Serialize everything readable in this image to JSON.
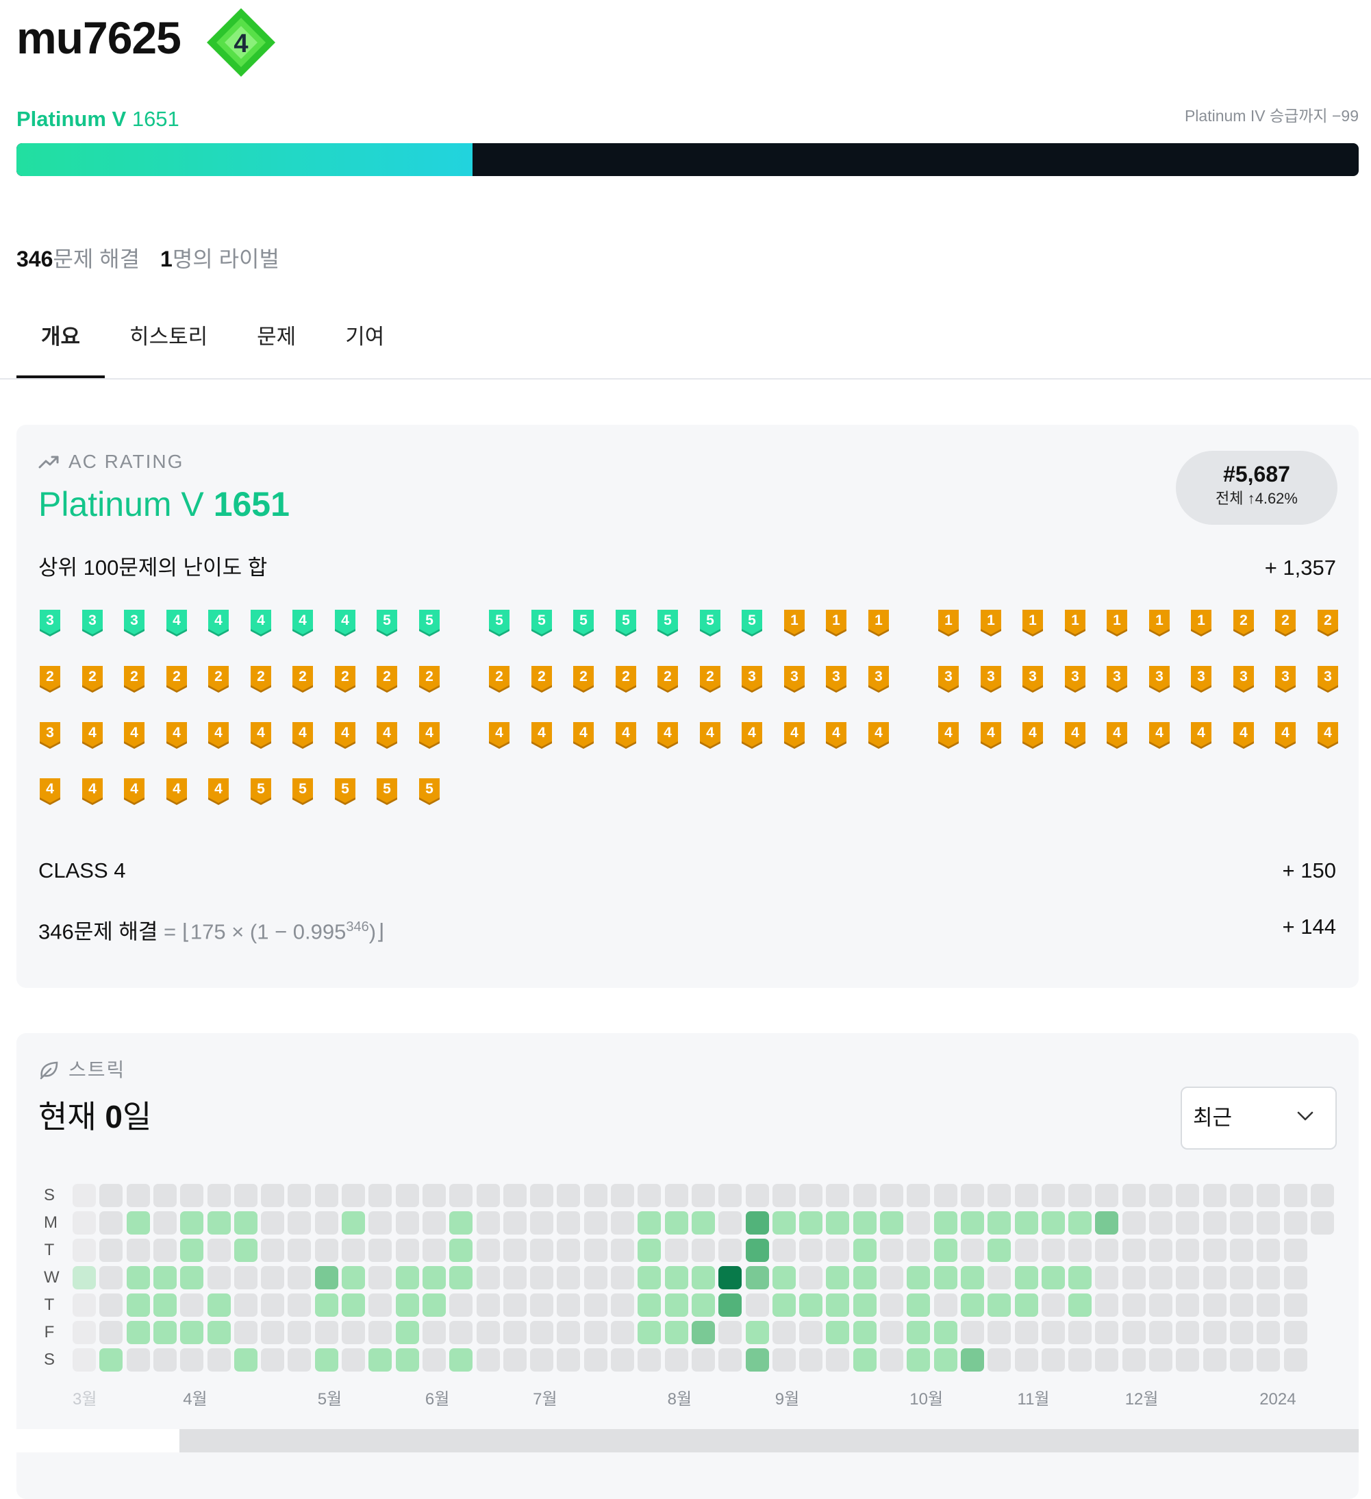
{
  "user": {
    "username": "mu7625",
    "class_badge": "4"
  },
  "rating": {
    "tier": "Platinum V",
    "value": "1651",
    "next_tier_text": "Platinum IV 승급까지 −99",
    "progress_fraction": 0.34
  },
  "stats": {
    "solved_count": "346",
    "solved_suffix": "문제 해결",
    "rivals_count": "1",
    "rivals_suffix": "명의 라이벌"
  },
  "tabs": [
    {
      "label": "개요",
      "active": true
    },
    {
      "label": "히스토리",
      "active": false
    },
    {
      "label": "문제",
      "active": false
    },
    {
      "label": "기여",
      "active": false
    }
  ],
  "ac_rating": {
    "label": "AC RATING",
    "tier": "Platinum V",
    "value": "1651",
    "rank": "#5,687",
    "rank_sub": "전체 ↑4.62%",
    "top100_label": "상위 100문제의 난이도 합",
    "top100_value": "+ 1,357",
    "class_label": "CLASS 4",
    "class_value": "+ 150",
    "solved_formula_prefix": "346문제 해결",
    "solved_formula_rest": " = ⌊175 × (1 − 0.995",
    "solved_formula_exp": "346",
    "solved_formula_end": ")⌋",
    "solved_formula_value": "+ 144",
    "badges": [
      {
        "tier": "platinum",
        "level": 3
      },
      {
        "tier": "platinum",
        "level": 3
      },
      {
        "tier": "platinum",
        "level": 3
      },
      {
        "tier": "platinum",
        "level": 4
      },
      {
        "tier": "platinum",
        "level": 4
      },
      {
        "tier": "platinum",
        "level": 4
      },
      {
        "tier": "platinum",
        "level": 4
      },
      {
        "tier": "platinum",
        "level": 4
      },
      {
        "tier": "platinum",
        "level": 5
      },
      {
        "tier": "platinum",
        "level": 5
      },
      {
        "tier": "platinum",
        "level": 5
      },
      {
        "tier": "platinum",
        "level": 5
      },
      {
        "tier": "platinum",
        "level": 5
      },
      {
        "tier": "platinum",
        "level": 5
      },
      {
        "tier": "platinum",
        "level": 5
      },
      {
        "tier": "platinum",
        "level": 5
      },
      {
        "tier": "platinum",
        "level": 5
      },
      {
        "tier": "gold",
        "level": 1
      },
      {
        "tier": "gold",
        "level": 1
      },
      {
        "tier": "gold",
        "level": 1
      },
      {
        "tier": "gold",
        "level": 1
      },
      {
        "tier": "gold",
        "level": 1
      },
      {
        "tier": "gold",
        "level": 1
      },
      {
        "tier": "gold",
        "level": 1
      },
      {
        "tier": "gold",
        "level": 1
      },
      {
        "tier": "gold",
        "level": 1
      },
      {
        "tier": "gold",
        "level": 1
      },
      {
        "tier": "gold",
        "level": 2
      },
      {
        "tier": "gold",
        "level": 2
      },
      {
        "tier": "gold",
        "level": 2
      },
      {
        "tier": "gold",
        "level": 2
      },
      {
        "tier": "gold",
        "level": 2
      },
      {
        "tier": "gold",
        "level": 2
      },
      {
        "tier": "gold",
        "level": 2
      },
      {
        "tier": "gold",
        "level": 2
      },
      {
        "tier": "gold",
        "level": 2
      },
      {
        "tier": "gold",
        "level": 2
      },
      {
        "tier": "gold",
        "level": 2
      },
      {
        "tier": "gold",
        "level": 2
      },
      {
        "tier": "gold",
        "level": 2
      },
      {
        "tier": "gold",
        "level": 2
      },
      {
        "tier": "gold",
        "level": 2
      },
      {
        "tier": "gold",
        "level": 2
      },
      {
        "tier": "gold",
        "level": 2
      },
      {
        "tier": "gold",
        "level": 2
      },
      {
        "tier": "gold",
        "level": 2
      },
      {
        "tier": "gold",
        "level": 3
      },
      {
        "tier": "gold",
        "level": 3
      },
      {
        "tier": "gold",
        "level": 3
      },
      {
        "tier": "gold",
        "level": 3
      },
      {
        "tier": "gold",
        "level": 3
      },
      {
        "tier": "gold",
        "level": 3
      },
      {
        "tier": "gold",
        "level": 3
      },
      {
        "tier": "gold",
        "level": 3
      },
      {
        "tier": "gold",
        "level": 3
      },
      {
        "tier": "gold",
        "level": 3
      },
      {
        "tier": "gold",
        "level": 3
      },
      {
        "tier": "gold",
        "level": 3
      },
      {
        "tier": "gold",
        "level": 3
      },
      {
        "tier": "gold",
        "level": 3
      },
      {
        "tier": "gold",
        "level": 3
      },
      {
        "tier": "gold",
        "level": 4
      },
      {
        "tier": "gold",
        "level": 4
      },
      {
        "tier": "gold",
        "level": 4
      },
      {
        "tier": "gold",
        "level": 4
      },
      {
        "tier": "gold",
        "level": 4
      },
      {
        "tier": "gold",
        "level": 4
      },
      {
        "tier": "gold",
        "level": 4
      },
      {
        "tier": "gold",
        "level": 4
      },
      {
        "tier": "gold",
        "level": 4
      },
      {
        "tier": "gold",
        "level": 4
      },
      {
        "tier": "gold",
        "level": 4
      },
      {
        "tier": "gold",
        "level": 4
      },
      {
        "tier": "gold",
        "level": 4
      },
      {
        "tier": "gold",
        "level": 4
      },
      {
        "tier": "gold",
        "level": 4
      },
      {
        "tier": "gold",
        "level": 4
      },
      {
        "tier": "gold",
        "level": 4
      },
      {
        "tier": "gold",
        "level": 4
      },
      {
        "tier": "gold",
        "level": 4
      },
      {
        "tier": "gold",
        "level": 4
      },
      {
        "tier": "gold",
        "level": 4
      },
      {
        "tier": "gold",
        "level": 4
      },
      {
        "tier": "gold",
        "level": 4
      },
      {
        "tier": "gold",
        "level": 4
      },
      {
        "tier": "gold",
        "level": 4
      },
      {
        "tier": "gold",
        "level": 4
      },
      {
        "tier": "gold",
        "level": 4
      },
      {
        "tier": "gold",
        "level": 4
      },
      {
        "tier": "gold",
        "level": 4
      },
      {
        "tier": "gold",
        "level": 4
      },
      {
        "tier": "gold",
        "level": 4
      },
      {
        "tier": "gold",
        "level": 4
      },
      {
        "tier": "gold",
        "level": 4
      },
      {
        "tier": "gold",
        "level": 4
      },
      {
        "tier": "gold",
        "level": 5
      },
      {
        "tier": "gold",
        "level": 5
      },
      {
        "tier": "gold",
        "level": 5
      },
      {
        "tier": "gold",
        "level": 5
      },
      {
        "tier": "gold",
        "level": 5
      }
    ]
  },
  "streak": {
    "label": "스트릭",
    "current_prefix": "현재 ",
    "current_days": "0",
    "current_suffix": "일",
    "range_select": "최근",
    "day_labels": [
      "S",
      "M",
      "T",
      "W",
      "T",
      "F",
      "S"
    ],
    "months": [
      {
        "label": "3월",
        "week": 0
      },
      {
        "label": "4월",
        "week": 4
      },
      {
        "label": "5월",
        "week": 9
      },
      {
        "label": "6월",
        "week": 13
      },
      {
        "label": "7월",
        "week": 17
      },
      {
        "label": "8월",
        "week": 22
      },
      {
        "label": "9월",
        "week": 26
      },
      {
        "label": "10월",
        "week": 31
      },
      {
        "label": "11월",
        "week": 35
      },
      {
        "label": "12월",
        "week": 39
      },
      {
        "label": "2024",
        "week": 44
      }
    ],
    "weeks": 47,
    "active_days": [
      [
        2,
        1,
        1
      ],
      [
        4,
        1,
        1
      ],
      [
        5,
        1,
        1
      ],
      [
        6,
        1,
        1
      ],
      [
        10,
        1,
        1
      ],
      [
        14,
        1,
        1
      ],
      [
        21,
        1,
        1
      ],
      [
        22,
        1,
        1
      ],
      [
        23,
        1,
        1
      ],
      [
        25,
        1,
        3
      ],
      [
        26,
        1,
        1
      ],
      [
        27,
        1,
        1
      ],
      [
        28,
        1,
        1
      ],
      [
        29,
        1,
        1
      ],
      [
        30,
        1,
        1
      ],
      [
        32,
        1,
        1
      ],
      [
        33,
        1,
        1
      ],
      [
        34,
        1,
        1
      ],
      [
        35,
        1,
        1
      ],
      [
        36,
        1,
        1
      ],
      [
        37,
        1,
        1
      ],
      [
        38,
        1,
        2
      ],
      [
        4,
        2,
        1
      ],
      [
        6,
        2,
        1
      ],
      [
        14,
        2,
        1
      ],
      [
        21,
        2,
        1
      ],
      [
        25,
        2,
        3
      ],
      [
        29,
        2,
        1
      ],
      [
        32,
        2,
        1
      ],
      [
        34,
        2,
        1
      ],
      [
        0,
        3,
        1
      ],
      [
        2,
        3,
        1
      ],
      [
        3,
        3,
        1
      ],
      [
        4,
        3,
        1
      ],
      [
        9,
        3,
        2
      ],
      [
        10,
        3,
        1
      ],
      [
        12,
        3,
        1
      ],
      [
        13,
        3,
        1
      ],
      [
        14,
        3,
        1
      ],
      [
        21,
        3,
        1
      ],
      [
        22,
        3,
        1
      ],
      [
        23,
        3,
        1
      ],
      [
        24,
        3,
        4
      ],
      [
        25,
        3,
        2
      ],
      [
        26,
        3,
        1
      ],
      [
        28,
        3,
        1
      ],
      [
        29,
        3,
        1
      ],
      [
        31,
        3,
        1
      ],
      [
        32,
        3,
        1
      ],
      [
        33,
        3,
        1
      ],
      [
        35,
        3,
        1
      ],
      [
        36,
        3,
        1
      ],
      [
        37,
        3,
        1
      ],
      [
        2,
        4,
        1
      ],
      [
        3,
        4,
        1
      ],
      [
        5,
        4,
        1
      ],
      [
        9,
        4,
        1
      ],
      [
        10,
        4,
        1
      ],
      [
        12,
        4,
        1
      ],
      [
        13,
        4,
        1
      ],
      [
        21,
        4,
        1
      ],
      [
        22,
        4,
        1
      ],
      [
        23,
        4,
        1
      ],
      [
        24,
        4,
        3
      ],
      [
        26,
        4,
        1
      ],
      [
        27,
        4,
        1
      ],
      [
        28,
        4,
        1
      ],
      [
        29,
        4,
        1
      ],
      [
        31,
        4,
        1
      ],
      [
        33,
        4,
        1
      ],
      [
        34,
        4,
        1
      ],
      [
        35,
        4,
        1
      ],
      [
        37,
        4,
        1
      ],
      [
        2,
        5,
        1
      ],
      [
        3,
        5,
        1
      ],
      [
        4,
        5,
        1
      ],
      [
        5,
        5,
        1
      ],
      [
        12,
        5,
        1
      ],
      [
        21,
        5,
        1
      ],
      [
        22,
        5,
        1
      ],
      [
        23,
        5,
        2
      ],
      [
        25,
        5,
        1
      ],
      [
        28,
        5,
        1
      ],
      [
        29,
        5,
        1
      ],
      [
        31,
        5,
        1
      ],
      [
        32,
        5,
        1
      ],
      [
        1,
        6,
        1
      ],
      [
        6,
        6,
        1
      ],
      [
        9,
        6,
        1
      ],
      [
        11,
        6,
        1
      ],
      [
        12,
        6,
        1
      ],
      [
        14,
        6,
        1
      ],
      [
        25,
        6,
        2
      ],
      [
        29,
        6,
        1
      ],
      [
        31,
        6,
        1
      ],
      [
        32,
        6,
        1
      ],
      [
        33,
        6,
        2
      ]
    ],
    "colors": {
      "empty": "#e1e2e4",
      "l1": "#a3e4b4",
      "l2": "#7ac995",
      "l3": "#52b37a",
      "l4": "#087a4a"
    }
  },
  "colors": {
    "accent": "#13c58a",
    "platinum": "#27e2a4",
    "gold": "#ec9a00",
    "class_badge": "#3ed43e"
  }
}
